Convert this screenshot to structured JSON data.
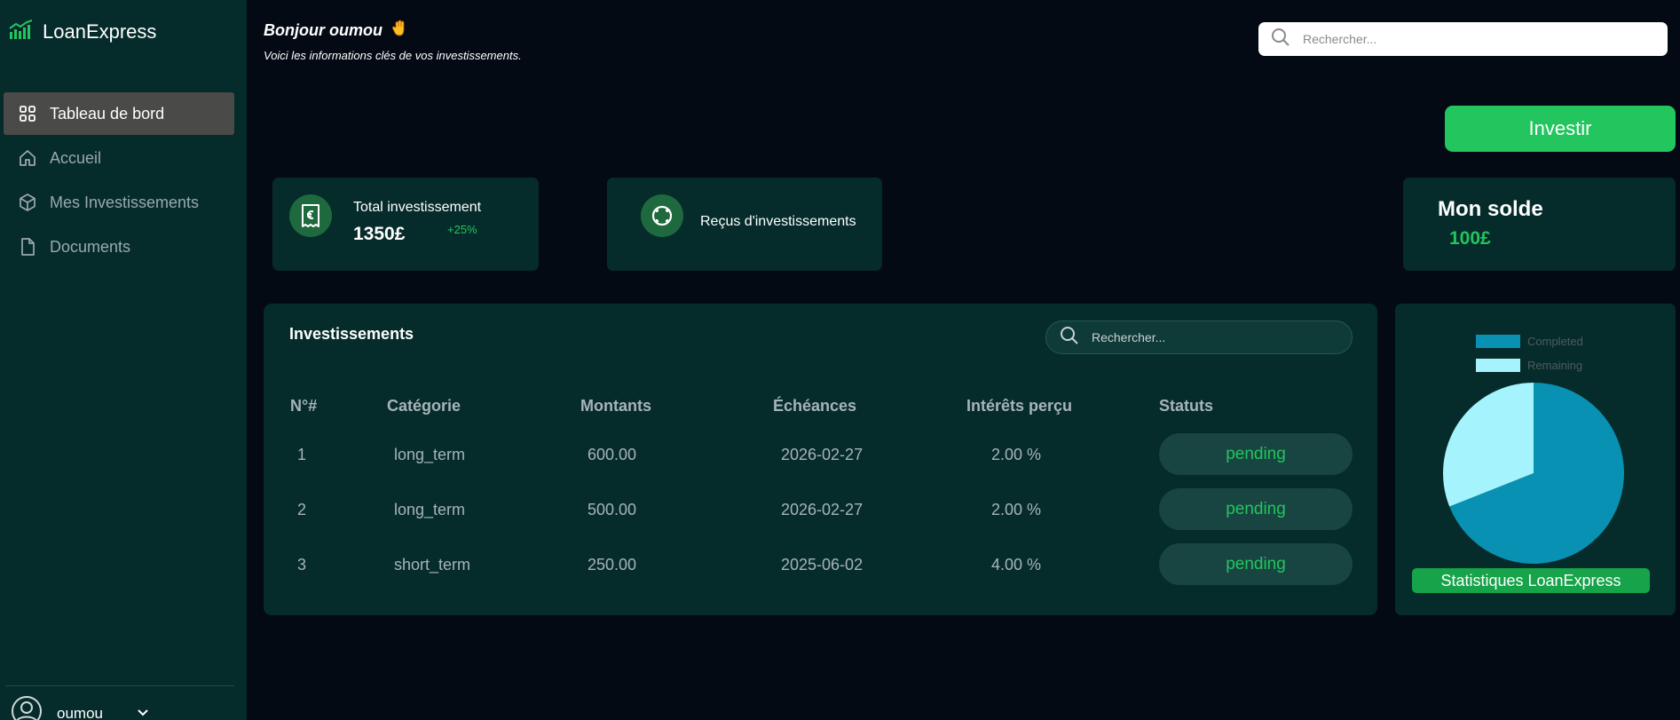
{
  "app": {
    "name": "LoanExpress"
  },
  "sidebar": {
    "items": [
      {
        "label": "Tableau de bord",
        "icon": "grid-icon",
        "active": true
      },
      {
        "label": "Accueil",
        "icon": "home-icon"
      },
      {
        "label": "Mes Investissements",
        "icon": "box-icon"
      },
      {
        "label": "Documents",
        "icon": "document-icon"
      }
    ],
    "user": {
      "name": "oumou"
    }
  },
  "header": {
    "greeting": "Bonjour oumou",
    "subtitle": "Voici les informations clés de vos investissements.",
    "search_placeholder": "Rechercher..."
  },
  "actions": {
    "invest_label": "Investir"
  },
  "cards": {
    "total": {
      "title": "Total investissement",
      "value": "1350£",
      "change": "+25%"
    },
    "receipts": {
      "title": "Reçus d'investissements"
    },
    "balance": {
      "title": "Mon solde",
      "value": "100£"
    }
  },
  "table": {
    "title": "Investissements",
    "search_placeholder": "Rechercher...",
    "columns": [
      "N°#",
      "Catégorie",
      "Montants",
      "Échéances",
      "Intérêts perçu",
      "Statuts"
    ],
    "rows": [
      {
        "num": "1",
        "category": "long_term",
        "amount": "600.00",
        "due": "2026-02-27",
        "interest": "2.00 %",
        "status": "pending"
      },
      {
        "num": "2",
        "category": "long_term",
        "amount": "500.00",
        "due": "2026-02-27",
        "interest": "2.00 %",
        "status": "pending"
      },
      {
        "num": "3",
        "category": "short_term",
        "amount": "250.00",
        "due": "2025-06-02",
        "interest": "4.00 %",
        "status": "pending"
      }
    ]
  },
  "chart": {
    "button_label": "Statistiques LoanExpress"
  },
  "chart_data": {
    "type": "pie",
    "categories": [
      "Completed",
      "Remaining"
    ],
    "values": [
      69,
      31
    ],
    "colors": [
      "#0891b2",
      "#a5f3fc"
    ],
    "legend": "top"
  }
}
